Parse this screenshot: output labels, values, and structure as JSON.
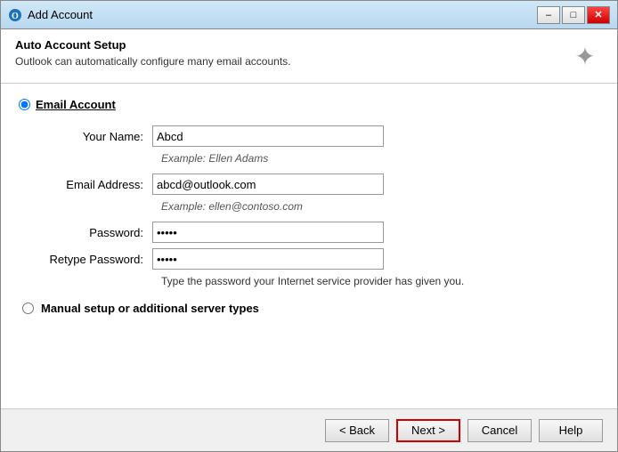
{
  "window": {
    "title": "Add Account",
    "icon": "outlook-icon"
  },
  "titlebar": {
    "minimize_label": "–",
    "maximize_label": "□",
    "close_label": "✕"
  },
  "auto_setup": {
    "heading": "Auto Account Setup",
    "description": "Outlook can automatically configure many email accounts."
  },
  "form": {
    "email_account_label": "Email Account",
    "your_name_label": "Your Name:",
    "your_name_value": "Abcd",
    "your_name_hint": "Example: Ellen Adams",
    "email_address_label": "Email Address:",
    "email_address_value": "abcd@outlook.com",
    "email_address_hint": "Example: ellen@contoso.com",
    "password_label": "Password:",
    "password_value": "*****",
    "retype_password_label": "Retype Password:",
    "retype_password_value": "*****",
    "password_hint": "Type the password your Internet service provider has given you.",
    "manual_setup_label": "Manual setup or additional server types"
  },
  "footer": {
    "back_label": "< Back",
    "next_label": "Next >",
    "cancel_label": "Cancel",
    "help_label": "Help"
  }
}
